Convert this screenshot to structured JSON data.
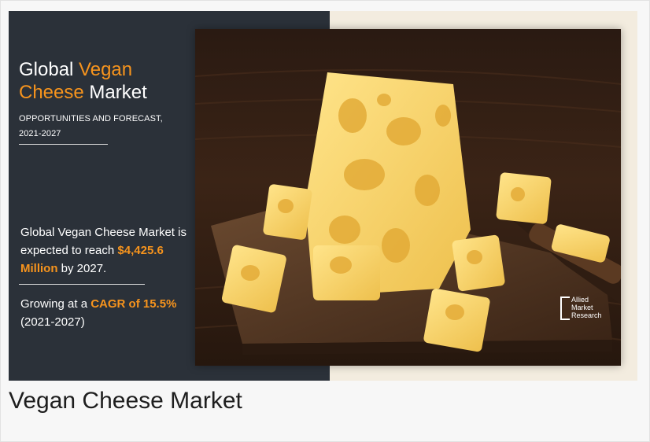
{
  "title": {
    "prefix": "Global ",
    "accent1": "Vegan",
    "accent2": "Cheese",
    "suffix": " Market"
  },
  "subtitle_line1": "OPPORTUNITIES AND FORECAST,",
  "subtitle_line2": "2021-2027",
  "stat_text1": "Global Vegan Cheese Market is expected to reach ",
  "stat_value": "$4,425.6 Million",
  "stat_text2": " by 2027.",
  "growth_text1": "Growing at a ",
  "growth_value": "CAGR of 15.5%",
  "growth_years": "(2021-2027)",
  "logo": {
    "line1": "Allied",
    "line2": "Market",
    "line3": "Research"
  },
  "caption": "Vegan Cheese Market",
  "colors": {
    "panel": "#2b3139",
    "accent": "#f7941d",
    "cheese": "#f6d26b",
    "wood": "#4a2e1c"
  }
}
